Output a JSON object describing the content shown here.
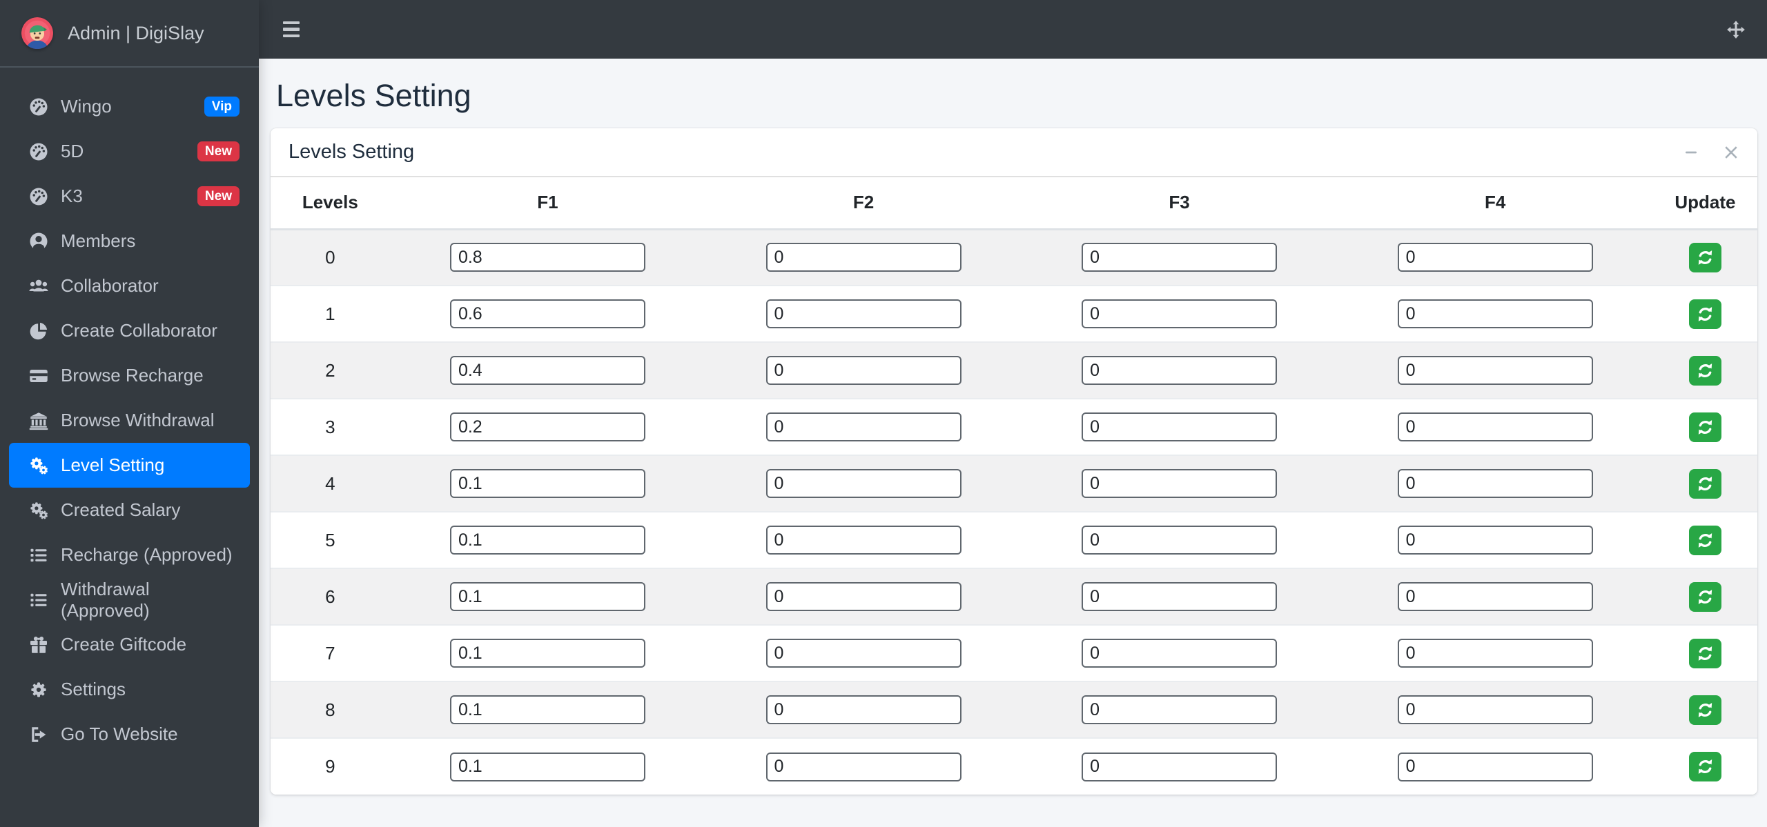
{
  "brand": {
    "title": "Admin | DigiSlay"
  },
  "page": {
    "title": "Levels Setting"
  },
  "card": {
    "title": "Levels Setting"
  },
  "sidebar": {
    "items": [
      {
        "label": "Wingo",
        "icon": "tachometer-icon",
        "badge": {
          "text": "Vip",
          "color": "#007bff"
        }
      },
      {
        "label": "5D",
        "icon": "tachometer-icon",
        "badge": {
          "text": "New",
          "color": "#dc3545"
        }
      },
      {
        "label": "K3",
        "icon": "tachometer-icon",
        "badge": {
          "text": "New",
          "color": "#dc3545"
        }
      },
      {
        "label": "Members",
        "icon": "user-circle-icon"
      },
      {
        "label": "Collaborator",
        "icon": "users-icon"
      },
      {
        "label": "Create Collaborator",
        "icon": "chart-pie-icon"
      },
      {
        "label": "Browse Recharge",
        "icon": "credit-card-icon"
      },
      {
        "label": "Browse Withdrawal",
        "icon": "bank-icon"
      },
      {
        "label": "Level Setting",
        "icon": "cogs-icon",
        "active": true
      },
      {
        "label": "Created Salary",
        "icon": "cogs-icon"
      },
      {
        "label": "Recharge (Approved)",
        "icon": "list-icon"
      },
      {
        "label": "Withdrawal (Approved)",
        "icon": "list-icon"
      },
      {
        "label": "Create Giftcode",
        "icon": "gift-icon"
      },
      {
        "label": "Settings",
        "icon": "gear-icon"
      },
      {
        "label": "Go To Website",
        "icon": "sign-out-icon"
      }
    ]
  },
  "table": {
    "headers": [
      "Levels",
      "F1",
      "F2",
      "F3",
      "F4",
      "Update"
    ],
    "rows": [
      {
        "level": "0",
        "f1": "0.8",
        "f2": "0",
        "f3": "0",
        "f4": "0"
      },
      {
        "level": "1",
        "f1": "0.6",
        "f2": "0",
        "f3": "0",
        "f4": "0"
      },
      {
        "level": "2",
        "f1": "0.4",
        "f2": "0",
        "f3": "0",
        "f4": "0"
      },
      {
        "level": "3",
        "f1": "0.2",
        "f2": "0",
        "f3": "0",
        "f4": "0"
      },
      {
        "level": "4",
        "f1": "0.1",
        "f2": "0",
        "f3": "0",
        "f4": "0"
      },
      {
        "level": "5",
        "f1": "0.1",
        "f2": "0",
        "f3": "0",
        "f4": "0"
      },
      {
        "level": "6",
        "f1": "0.1",
        "f2": "0",
        "f3": "0",
        "f4": "0"
      },
      {
        "level": "7",
        "f1": "0.1",
        "f2": "0",
        "f3": "0",
        "f4": "0"
      },
      {
        "level": "8",
        "f1": "0.1",
        "f2": "0",
        "f3": "0",
        "f4": "0"
      },
      {
        "level": "9",
        "f1": "0.1",
        "f2": "0",
        "f3": "0",
        "f4": "0"
      }
    ]
  },
  "colors": {
    "accent": "#007bff",
    "success": "#28a745",
    "danger": "#dc3545",
    "sidebar_bg": "#343a40",
    "page_bg": "#f4f6f9"
  }
}
